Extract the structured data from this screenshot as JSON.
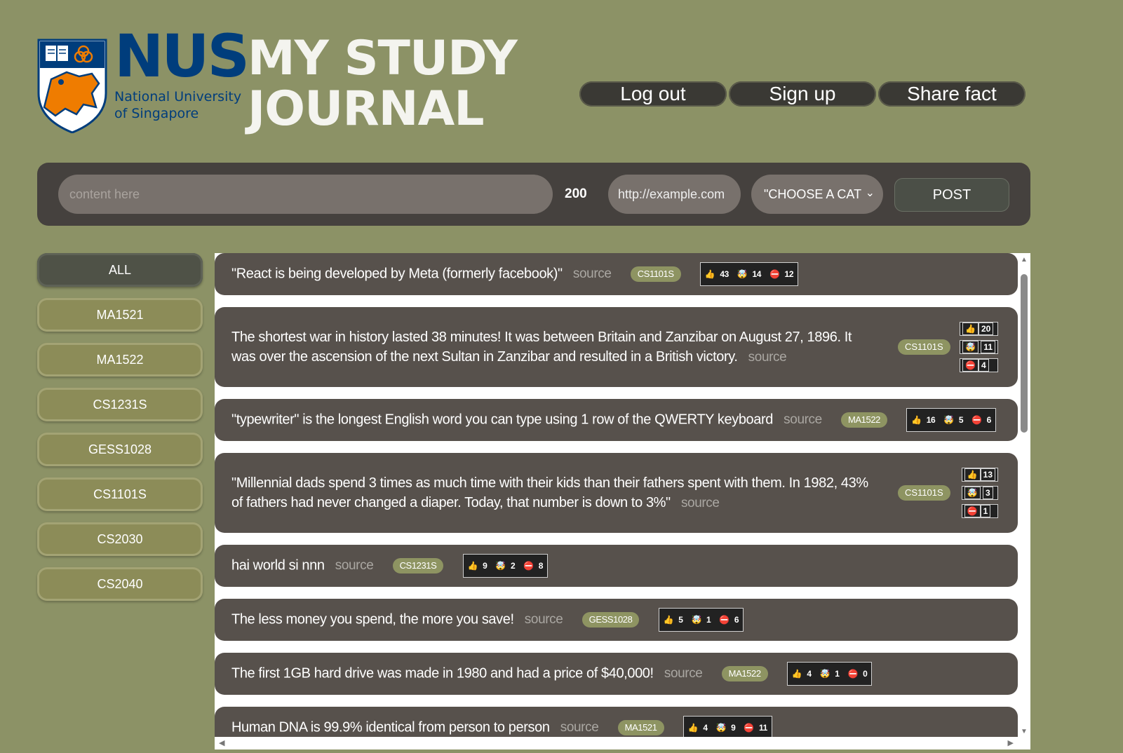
{
  "header": {
    "logo_text": "NUS",
    "logo_sub1": "National University",
    "logo_sub2": "of Singapore",
    "title_line1": "MY STUDY",
    "title_line2": "JOURNAL",
    "nav": [
      "Log out",
      "Sign up",
      "Share fact"
    ]
  },
  "form": {
    "content_placeholder": "content here",
    "char_count": "200",
    "url_placeholder": "http://example.com",
    "category_selected": "\"CHOOSE A CATEGORY\"",
    "post_label": "POST"
  },
  "sidebar": {
    "categories": [
      "ALL",
      "MA1521",
      "MA1522",
      "CS1231S",
      "GESS1028",
      "CS1101S",
      "CS2030",
      "CS2040"
    ]
  },
  "source_label": "source",
  "icons": {
    "like": "thumbs-up-icon",
    "mind_blown": "mind-blown-icon",
    "false": "no-entry-icon"
  },
  "colors": {
    "background": "#8c9266",
    "card": "#57514c",
    "tag": "#8e9462",
    "nus_blue": "#003d7c"
  },
  "facts": [
    {
      "text": "\"React is being developed by Meta (formerly facebook)\"",
      "tag": "CS1101S",
      "likes": "43",
      "mind": "14",
      "false": "12"
    },
    {
      "text": "The shortest war in history lasted 38 minutes! It was between Britain and Zanzibar on August 27, 1896. It was over the ascension of the next Sultan in Zanzibar and resulted in a British victory.",
      "tag": "CS1101S",
      "likes": "20",
      "mind": "11",
      "false": "4"
    },
    {
      "text": "\"typewriter\" is the longest English word you can type using 1 row of the QWERTY keyboard",
      "tag": "MA1522",
      "likes": "16",
      "mind": "5",
      "false": "6"
    },
    {
      "text": "\"Millennial dads spend 3 times as much time with their kids than their fathers spent with them. In 1982, 43% of fathers had never changed a diaper. Today, that number is down to 3%\"",
      "tag": "CS1101S",
      "likes": "13",
      "mind": "3",
      "false": "1"
    },
    {
      "text": "hai world si nnn",
      "tag": "CS1231S",
      "likes": "9",
      "mind": "2",
      "false": "8"
    },
    {
      "text": "The less money you spend, the more you save!",
      "tag": "GESS1028",
      "likes": "5",
      "mind": "1",
      "false": "6"
    },
    {
      "text": "The first 1GB hard drive was made in 1980 and had a price of $40,000!",
      "tag": "MA1522",
      "likes": "4",
      "mind": "1",
      "false": "0"
    },
    {
      "text": "Human DNA is 99.9% identical from person to person",
      "tag": "MA1521",
      "likes": "4",
      "mind": "9",
      "false": "11"
    }
  ]
}
